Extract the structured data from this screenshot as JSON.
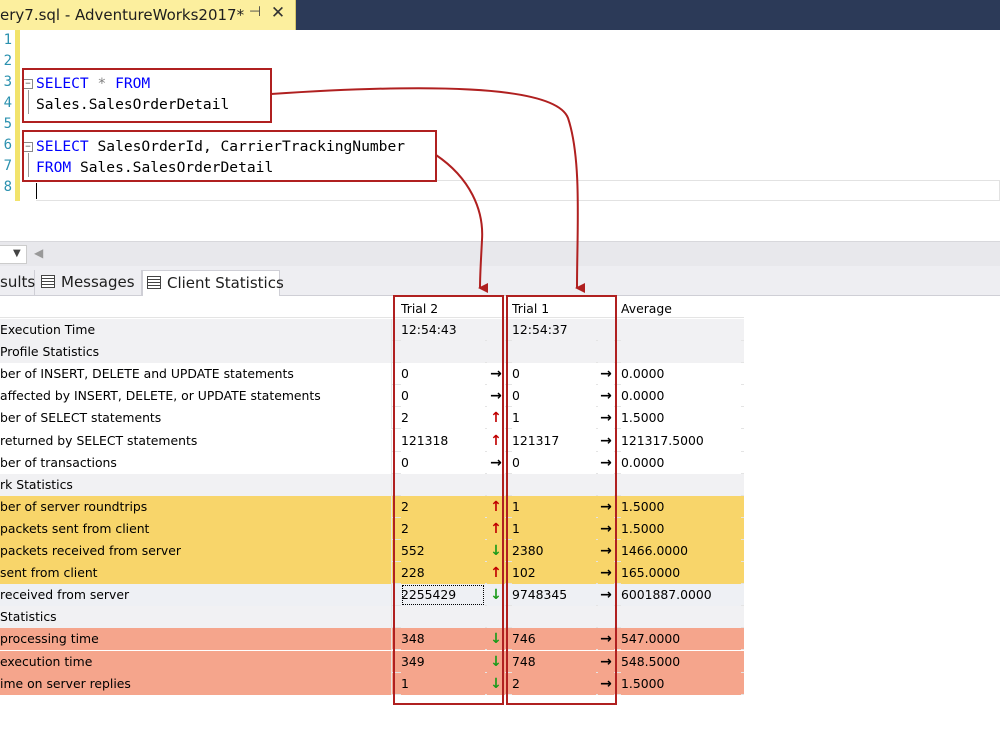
{
  "window": {
    "doc_tab_title": "ery7.sql - AdventureWorks2017*"
  },
  "editor": {
    "line_numbers": [
      "1",
      "2",
      "3",
      "4",
      "5",
      "6",
      "7",
      "8"
    ],
    "line3_kw1": "SELECT",
    "line3_star": " * ",
    "line3_kw2": "FROM",
    "line4": "Sales.SalesOrderDetail",
    "line6_kw": "SELECT",
    "line6_rest": " SalesOrderId, CarrierTrackingNumber",
    "line7_kw": "FROM",
    "line7_rest": " Sales.SalesOrderDetail"
  },
  "results_tabs": {
    "results": "sults",
    "messages": "Messages",
    "client_statistics": "Client Statistics"
  },
  "colors": {
    "annotation_red": "#b02020",
    "network_highlight": "#f8d56a",
    "time_highlight": "#f5a58c",
    "up_arrow": "#c00000",
    "down_arrow": "#1a9a1a"
  },
  "stats": {
    "headers": {
      "trial2": "Trial  2",
      "trial1": "Trial  1",
      "average": "Average"
    },
    "rows": [
      {
        "label": " Execution Time",
        "t2": "12:54:43",
        "t2_dir": "",
        "t1": "12:54:37",
        "t1_dir": "",
        "avg": "",
        "bg": "gray"
      },
      {
        "label": " Profile Statistics",
        "t2": "",
        "t2_dir": "",
        "t1": "",
        "t1_dir": "",
        "avg": "",
        "bg": "gray"
      },
      {
        "label": "ber of INSERT, DELETE and UPDATE statements",
        "t2": "0",
        "t2_dir": "→",
        "t1": "0",
        "t1_dir": "→",
        "avg": "0.0000",
        "bg": "white"
      },
      {
        "label": " affected by INSERT, DELETE, or UPDATE statements",
        "t2": "0",
        "t2_dir": "→",
        "t1": "0",
        "t1_dir": "→",
        "avg": "0.0000",
        "bg": "white"
      },
      {
        "label": "ber of SELECT statements",
        "t2": "2",
        "t2_dir": "↑",
        "t1": "1",
        "t1_dir": "→",
        "avg": "1.5000",
        "bg": "white"
      },
      {
        "label": " returned by SELECT statements",
        "t2": "121318",
        "t2_dir": "↑",
        "t1": "121317",
        "t1_dir": "→",
        "avg": "121317.5000",
        "bg": "white"
      },
      {
        "label": "ber of transactions",
        "t2": "0",
        "t2_dir": "→",
        "t1": "0",
        "t1_dir": "→",
        "avg": "0.0000",
        "bg": "white"
      },
      {
        "label": "rk Statistics",
        "t2": "",
        "t2_dir": "",
        "t1": "",
        "t1_dir": "",
        "avg": "",
        "bg": "gray"
      },
      {
        "label": "ber of server roundtrips",
        "t2": "2",
        "t2_dir": "↑",
        "t1": "1",
        "t1_dir": "→",
        "avg": "1.5000",
        "bg": "yellow"
      },
      {
        "label": "packets sent from client",
        "t2": "2",
        "t2_dir": "↑",
        "t1": "1",
        "t1_dir": "→",
        "avg": "1.5000",
        "bg": "yellow"
      },
      {
        "label": "packets received from server",
        "t2": "552",
        "t2_dir": "↓",
        "t1": "2380",
        "t1_dir": "→",
        "avg": "1466.0000",
        "bg": "yellow"
      },
      {
        "label": "sent from client",
        "t2": "228",
        "t2_dir": "↑",
        "t1": "102",
        "t1_dir": "→",
        "avg": "165.0000",
        "bg": "yellow"
      },
      {
        "label": "received from server",
        "t2": "2255429",
        "t2_dir": "↓",
        "t1": "9748345",
        "t1_dir": "→",
        "avg": "6001887.0000",
        "bg": "selected"
      },
      {
        "label": "Statistics",
        "t2": "",
        "t2_dir": "",
        "t1": "",
        "t1_dir": "",
        "avg": "",
        "bg": "gray"
      },
      {
        "label": " processing time",
        "t2": "348",
        "t2_dir": "↓",
        "t1": "746",
        "t1_dir": "→",
        "avg": "547.0000",
        "bg": "salmon"
      },
      {
        "label": "execution time",
        "t2": "349",
        "t2_dir": "↓",
        "t1": "748",
        "t1_dir": "→",
        "avg": "548.5000",
        "bg": "salmon"
      },
      {
        "label": "ime on server replies",
        "t2": "1",
        "t2_dir": "↓",
        "t1": "2",
        "t1_dir": "→",
        "avg": "1.5000",
        "bg": "salmon"
      }
    ]
  }
}
